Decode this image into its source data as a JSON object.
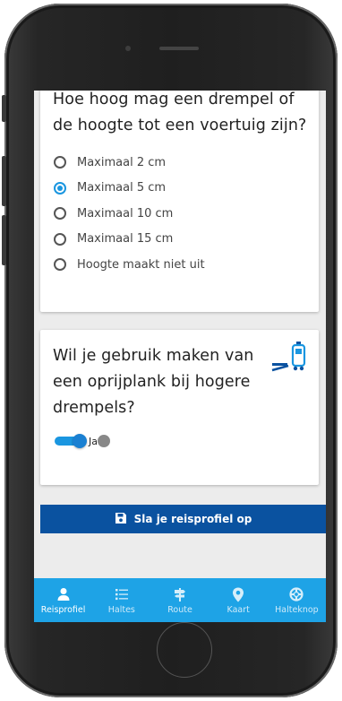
{
  "question1": {
    "title": "Hoe hoog mag een drempel of de hoogte tot een voertuig zijn?",
    "options": [
      {
        "label": "Maximaal 2 cm",
        "selected": false
      },
      {
        "label": "Maximaal 5 cm",
        "selected": true
      },
      {
        "label": "Maximaal 10 cm",
        "selected": false
      },
      {
        "label": "Maximaal 15 cm",
        "selected": false
      },
      {
        "label": "Hoogte maakt niet uit",
        "selected": false
      }
    ]
  },
  "question2": {
    "title": "Wil je gebruik maken van een oprijplank bij hogere drempels?",
    "icon": "ramp-vehicle-icon",
    "toggle_label": "Ja",
    "toggle_on": true
  },
  "save_button": {
    "label": "Sla je reisprofiel op",
    "icon": "save-icon"
  },
  "nav": {
    "items": [
      {
        "label": "Reisprofiel",
        "icon": "person-icon",
        "active": true
      },
      {
        "label": "Haltes",
        "icon": "list-icon",
        "active": false
      },
      {
        "label": "Route",
        "icon": "signpost-icon",
        "active": false
      },
      {
        "label": "Kaart",
        "icon": "map-pin-icon",
        "active": false
      },
      {
        "label": "Halteknop",
        "icon": "lifebuoy-icon",
        "active": false
      }
    ]
  },
  "colors": {
    "accent": "#1a96e0",
    "nav_bg": "#1ea3e6",
    "save_bg": "#0a52a0",
    "screen_bg": "#ececec"
  }
}
